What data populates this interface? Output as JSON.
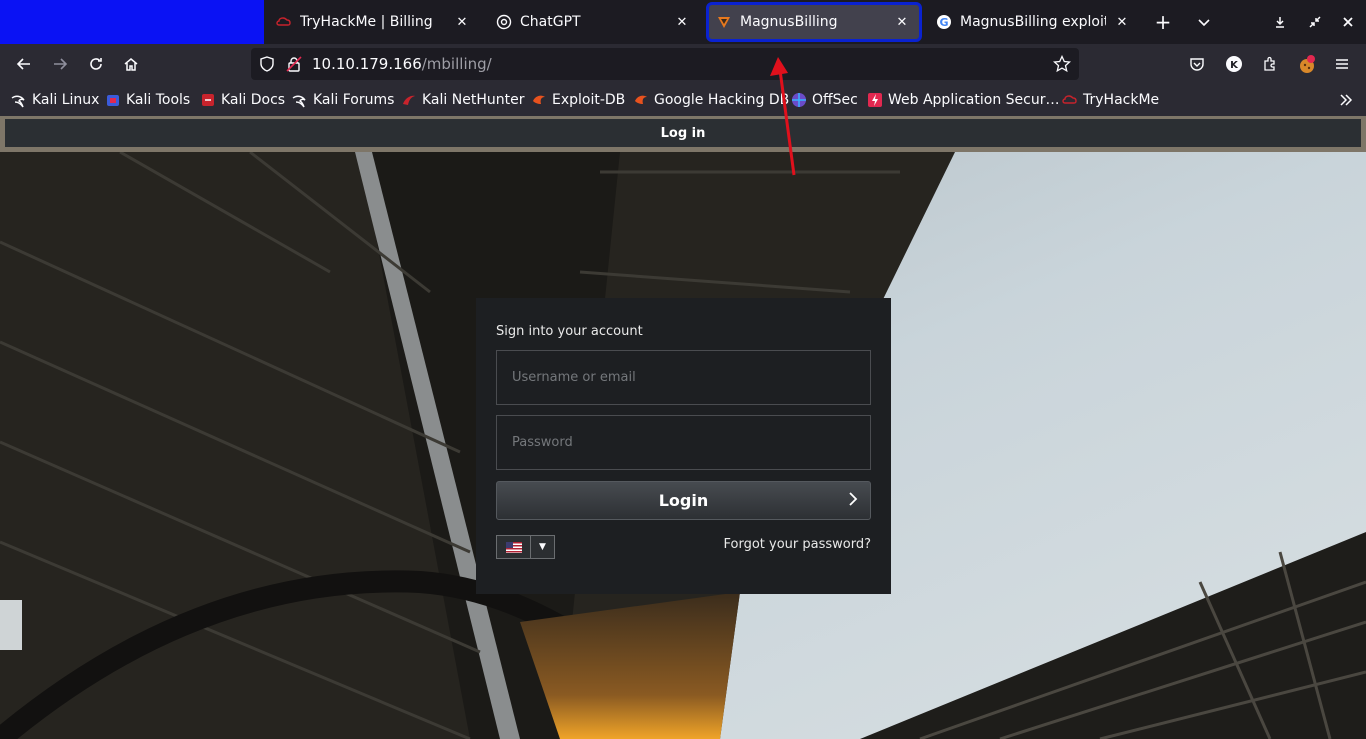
{
  "tabs": [
    {
      "title": "TryHackMe | Billing",
      "icon": "tryhackme-icon"
    },
    {
      "title": "ChatGPT",
      "icon": "chatgpt-icon"
    },
    {
      "title": "MagnusBilling",
      "icon": "magnusbilling-icon",
      "active": true
    },
    {
      "title": "MagnusBilling exploit - G",
      "icon": "google-icon"
    }
  ],
  "address": {
    "host": "10.10.179.166",
    "path": "/mbilling/"
  },
  "bookmarks": [
    {
      "label": "Kali Linux",
      "icon": "kali-icon"
    },
    {
      "label": "Kali Tools",
      "icon": "kali-tools-icon"
    },
    {
      "label": "Kali Docs",
      "icon": "kali-docs-icon"
    },
    {
      "label": "Kali Forums",
      "icon": "kali-icon"
    },
    {
      "label": "Kali NetHunter",
      "icon": "nethunter-icon"
    },
    {
      "label": "Exploit-DB",
      "icon": "exploitdb-icon"
    },
    {
      "label": "Google Hacking DB",
      "icon": "exploitdb-icon"
    },
    {
      "label": "OffSec",
      "icon": "offsec-icon"
    },
    {
      "label": "Web Application Secur…",
      "icon": "webapp-icon"
    },
    {
      "label": "TryHackMe",
      "icon": "tryhackme-icon"
    }
  ],
  "page": {
    "title_bar": "Log in",
    "form": {
      "heading": "Sign into your account",
      "username_placeholder": "Username or email",
      "password_placeholder": "Password",
      "login_label": "Login",
      "forgot_label": "Forgot your password?",
      "language": "en-US"
    }
  },
  "colors": {
    "accent_outline": "#0a22d0",
    "annotation_arrow": "#e0101c",
    "top_left_block": "#0a12f4"
  }
}
